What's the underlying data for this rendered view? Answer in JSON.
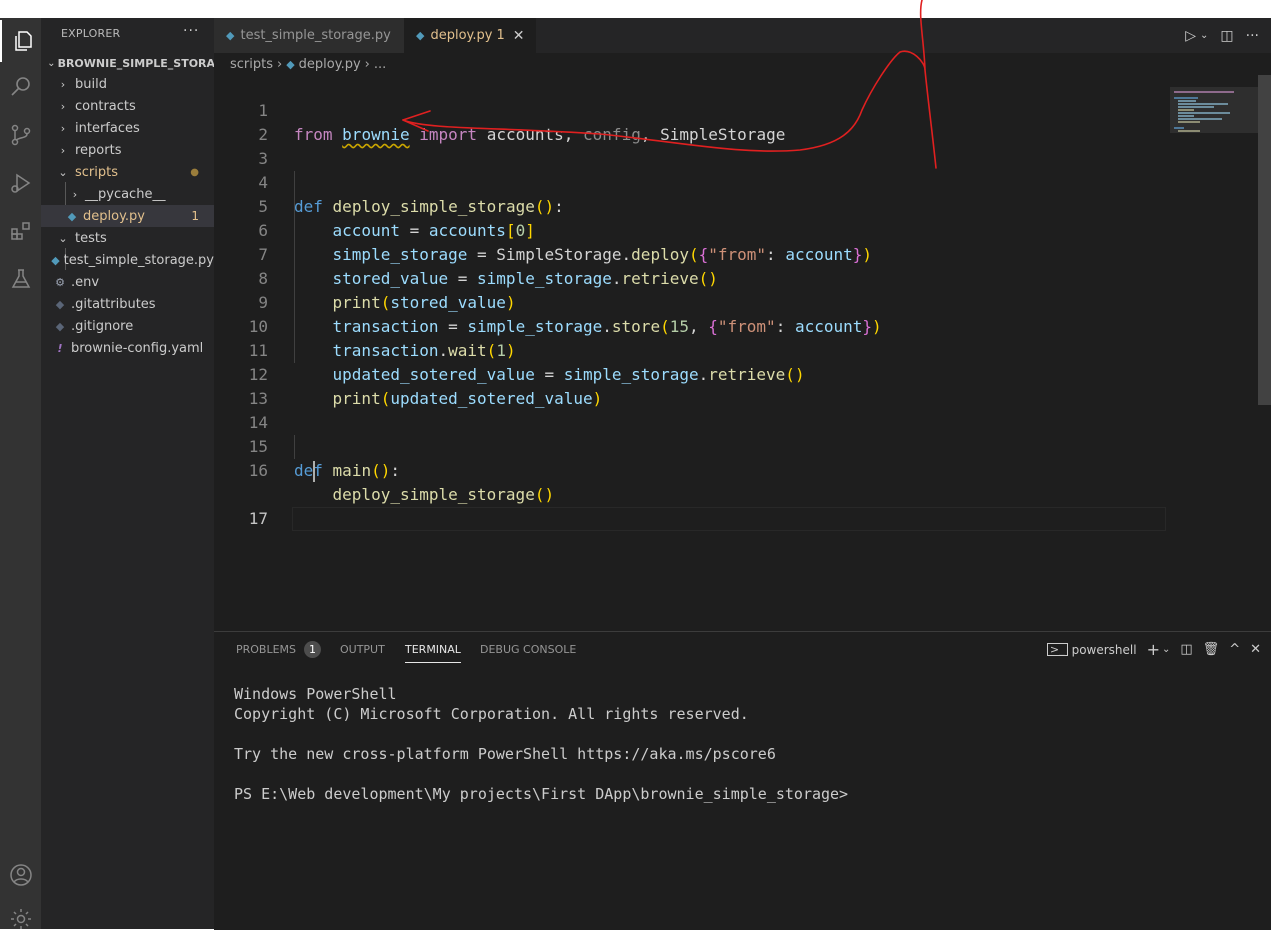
{
  "sidebar": {
    "title": "EXPLORER",
    "more": "···",
    "project": "BROWNIE_SIMPLE_STORAGE",
    "items": [
      {
        "label": "build"
      },
      {
        "label": "contracts"
      },
      {
        "label": "interfaces"
      },
      {
        "label": "reports"
      },
      {
        "label": "scripts"
      },
      {
        "label": "__pycache__"
      },
      {
        "label": "deploy.py",
        "badge": "1"
      },
      {
        "label": "tests"
      },
      {
        "label": "test_simple_storage.py"
      },
      {
        "label": ".env"
      },
      {
        "label": ".gitattributes"
      },
      {
        "label": ".gitignore"
      },
      {
        "label": "brownie-config.yaml",
        "icon": "!"
      }
    ]
  },
  "tabs": [
    {
      "label": "test_simple_storage.py"
    },
    {
      "label": "deploy.py",
      "count": "1",
      "close": "✕"
    }
  ],
  "breadcrumb": {
    "folder": "scripts",
    "file": "deploy.py",
    "rest": "..."
  },
  "editor": {
    "line_numbers": [
      "1",
      "2",
      "3",
      "4",
      "5",
      "6",
      "7",
      "8",
      "9",
      "10",
      "11",
      "12",
      "13",
      "14",
      "15",
      "16",
      "17"
    ],
    "tokens": {
      "l1": {
        "from": "from",
        "mod": "brownie",
        "import": "import",
        "a": "accounts",
        "c1": ",",
        "b": "config",
        "c2": ",",
        "c": "SimpleStorage"
      },
      "l4": {
        "def": "def",
        "fn": "deploy_simple_storage",
        "o": "(",
        "c": ")",
        "colon": ":"
      },
      "l5": {
        "v": "account",
        "eq": " = ",
        "a": "accounts",
        "o": "[",
        "n": "0",
        "c": "]"
      },
      "l6": {
        "v": "simple_storage",
        "eq": " = ",
        "cls": "SimpleStorage",
        "dot": ".",
        "m": "deploy",
        "o": "(",
        "bo": "{",
        "s": "\"from\"",
        "col": ": ",
        "a": "account",
        "bc": "}",
        "c": ")"
      },
      "l7": {
        "v": "stored_value",
        "eq": " = ",
        "obj": "simple_storage",
        "dot": ".",
        "m": "retrieve",
        "o": "(",
        "c": ")"
      },
      "l8": {
        "fn": "print",
        "o": "(",
        "a": "stored_value",
        "c": ")"
      },
      "l9": {
        "v": "transaction",
        "eq": " = ",
        "obj": "simple_storage",
        "dot": ".",
        "m": "store",
        "o": "(",
        "n": "15",
        "com": ", ",
        "bo": "{",
        "s": "\"from\"",
        "col": ": ",
        "a": "account",
        "bc": "}",
        "c": ")"
      },
      "l10": {
        "obj": "transaction",
        "dot": ".",
        "m": "wait",
        "o": "(",
        "n": "1",
        "c": ")"
      },
      "l11": {
        "v": "updated_sotered_value",
        "eq": " = ",
        "obj": "simple_storage",
        "dot": ".",
        "m": "retrieve",
        "o": "(",
        "c": ")"
      },
      "l12": {
        "fn": "print",
        "o": "(",
        "a": "updated_sotered_value",
        "c": ")"
      },
      "l15": {
        "def": "def",
        "fn": "main",
        "o": "(",
        "c": ")",
        "colon": ":"
      },
      "l16": {
        "fn": "deploy_simple_storage",
        "o": "(",
        "c": ")"
      }
    }
  },
  "panel": {
    "tabs": [
      {
        "label": "PROBLEMS",
        "badge": "1"
      },
      {
        "label": "OUTPUT"
      },
      {
        "label": "TERMINAL"
      },
      {
        "label": "DEBUG CONSOLE"
      }
    ],
    "shell": "powershell",
    "terminal": [
      "Windows PowerShell",
      "Copyright (C) Microsoft Corporation. All rights reserved.",
      "",
      "Try the new cross-platform PowerShell https://aka.ms/pscore6",
      "",
      "PS E:\\Web development\\My projects\\First DApp\\brownie_simple_storage>"
    ]
  },
  "colors": {
    "modified": "#e2c08d",
    "keyword": "#c586c0",
    "def": "#569cd6",
    "function": "#dcdcaa",
    "variable": "#9cdcfe",
    "string": "#ce9178",
    "number": "#b5cea8",
    "annotation_pen": "#e02020"
  }
}
